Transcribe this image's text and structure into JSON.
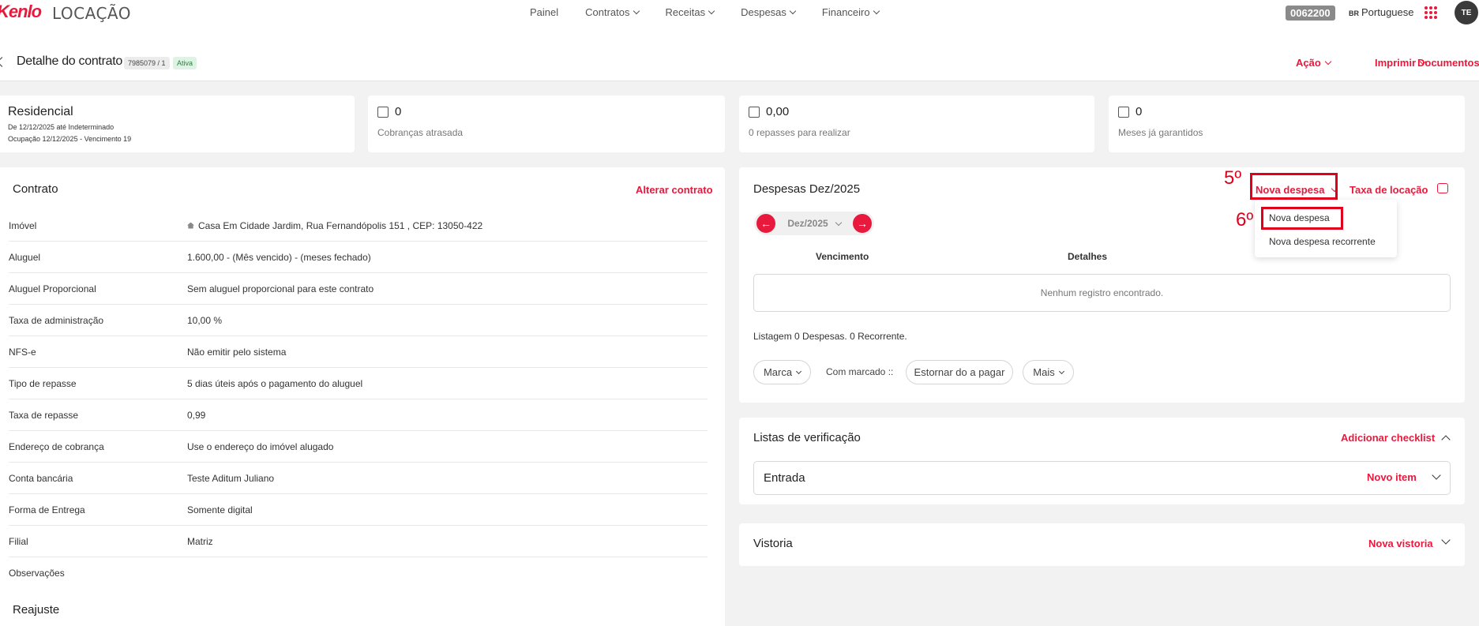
{
  "header": {
    "logo_main": "Kenlo",
    "logo_sub": "LOCAÇÃO",
    "nav": [
      {
        "label": "Painel"
      },
      {
        "label": "Contratos"
      },
      {
        "label": "Receitas"
      },
      {
        "label": "Despesas"
      },
      {
        "label": "Financeiro"
      }
    ],
    "code_badge": "0062200",
    "lang_flag": "BR",
    "language": "Portuguese",
    "avatar": "TE"
  },
  "titlebar": {
    "title": "Detalhe do contrato",
    "contract_id": "7985079 / 1",
    "status": "Ativa",
    "actions": [
      "Ação",
      "Imprimir",
      "Documentos"
    ]
  },
  "summary": {
    "type_title": "Residencial",
    "period": "De 12/12/2025 até Indeterminado",
    "occupation": "Ocupação 12/12/2025 - Vencimento 19",
    "late_count": "0",
    "late_label": "Cobranças atrasada",
    "repasses_value": "0,00",
    "repasses_label": "0 repasses para realizar",
    "months_value": "0",
    "months_label": "Meses já garantidos"
  },
  "contract": {
    "title": "Contrato",
    "edit_link": "Alterar contrato",
    "rows": [
      {
        "k": "Imóvel",
        "v": "Casa Em Cidade Jardim, Rua Fernandópolis 151 , CEP: 13050-422"
      },
      {
        "k": "Aluguel",
        "v": "1.600,00 - (Mês vencido) - (meses fechado)"
      },
      {
        "k": "Aluguel Proporcional",
        "v": "Sem aluguel proporcional para este contrato"
      },
      {
        "k": "Taxa de administração",
        "v": "10,00 %"
      },
      {
        "k": "NFS-e",
        "v": "Não emitir pelo sistema"
      },
      {
        "k": "Tipo de repasse",
        "v": "5 dias úteis após o pagamento do aluguel"
      },
      {
        "k": "Taxa de repasse",
        "v": "0,99"
      },
      {
        "k": "Endereço de cobrança",
        "v": "Use o endereço do imóvel alugado"
      },
      {
        "k": "Conta bancária",
        "v": "Teste Aditum Juliano"
      },
      {
        "k": "Forma de Entrega",
        "v": "Somente digital"
      },
      {
        "k": "Filial",
        "v": "Matriz"
      },
      {
        "k": "Observações",
        "v": ""
      }
    ],
    "reajuste_title": "Reajuste"
  },
  "despesas": {
    "title": "Despesas Dez/2025",
    "new_button": "Nova despesa",
    "tax_link": "Taxa de locação",
    "month": "Dez/2025",
    "col_vencimento": "Vencimento",
    "col_detalhes": "Detalhes",
    "empty": "Nenhum registro encontrado.",
    "summary": "Listagem 0 Despesas. 0 Recorrente.",
    "marca": "Marca",
    "com_marcado": "Com marcado ::",
    "estornar": "Estornar do a pagar",
    "mais": "Mais",
    "dropdown": [
      "Nova despesa",
      "Nova despesa recorrente"
    ],
    "step5": "5º",
    "step6": "6º"
  },
  "checklist": {
    "title": "Listas de verificação",
    "add_link": "Adicionar checklist",
    "entry": "Entrada",
    "new_item": "Novo item"
  },
  "vistoria": {
    "title": "Vistoria",
    "new_link": "Nova vistoria"
  },
  "colors": {
    "accent": "#e8193c",
    "annotation": "#e0001b",
    "status_green_bg": "#dff3e4"
  }
}
